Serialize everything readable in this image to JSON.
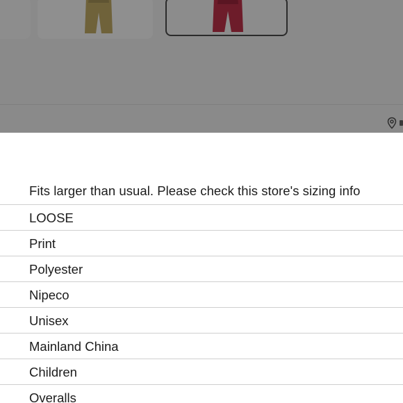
{
  "header": {
    "location_icon": "map-pin-icon"
  },
  "thumbnails": [
    {
      "name": "partial",
      "selected": false
    },
    {
      "name": "khaki-pants",
      "selected": false,
      "color": "#7a6a3c"
    },
    {
      "name": "red-pants",
      "selected": true,
      "color": "#7a1f2e"
    }
  ],
  "sheet": {
    "fit_note": "Fits larger than usual. Please check this store's sizing info",
    "attributes": [
      "LOOSE",
      "Print",
      "Polyester",
      "Nipeco",
      "Unisex",
      "Mainland China",
      "Children",
      "Overalls"
    ]
  },
  "colors": {
    "overlay": "#8a8a8a",
    "divider": "#cfcfcf",
    "text": "#1c1c1c",
    "selected_border": "#2b2b2b"
  }
}
